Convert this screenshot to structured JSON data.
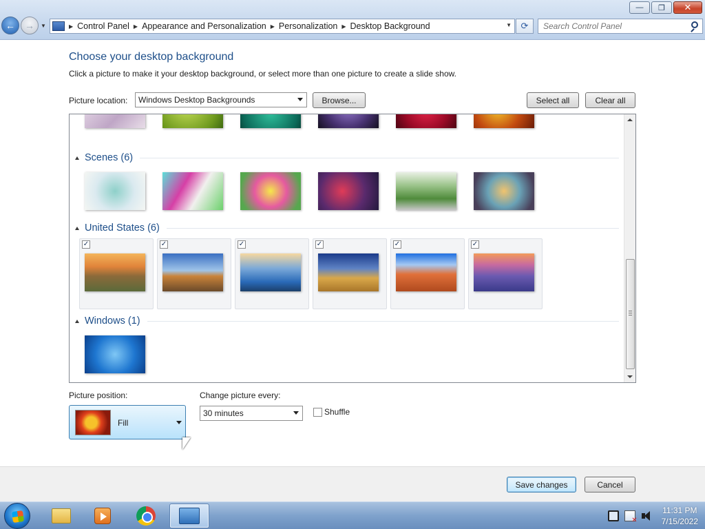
{
  "window": {
    "breadcrumbs": [
      "Control Panel",
      "Appearance and Personalization",
      "Personalization",
      "Desktop Background"
    ],
    "search_placeholder": "Search Control Panel",
    "buttons": {
      "minimize": "—",
      "restore": "❐",
      "close": "✕"
    }
  },
  "page": {
    "heading": "Choose your desktop background",
    "subtext": "Click a picture to make it your desktop background, or select more than one picture to create a slide show.",
    "picture_location_label": "Picture location:",
    "picture_location_value": "Windows Desktop Backgrounds",
    "browse_label": "Browse...",
    "select_all_label": "Select all",
    "clear_all_label": "Clear all"
  },
  "groups": [
    {
      "title": "Scenes (6)",
      "checked": false
    },
    {
      "title": "United States (6)",
      "checked": true
    },
    {
      "title": "Windows (1)",
      "checked": false
    }
  ],
  "options": {
    "picture_position_label": "Picture position:",
    "picture_position_value": "Fill",
    "change_every_label": "Change picture every:",
    "change_every_value": "30 minutes",
    "shuffle_label": "Shuffle",
    "shuffle_checked": false
  },
  "footer": {
    "save_label": "Save changes",
    "cancel_label": "Cancel"
  },
  "taskbar": {
    "apps": [
      "file-explorer",
      "media-player",
      "chrome",
      "control-panel"
    ],
    "time": "11:31 PM",
    "date": "7/15/2022"
  }
}
